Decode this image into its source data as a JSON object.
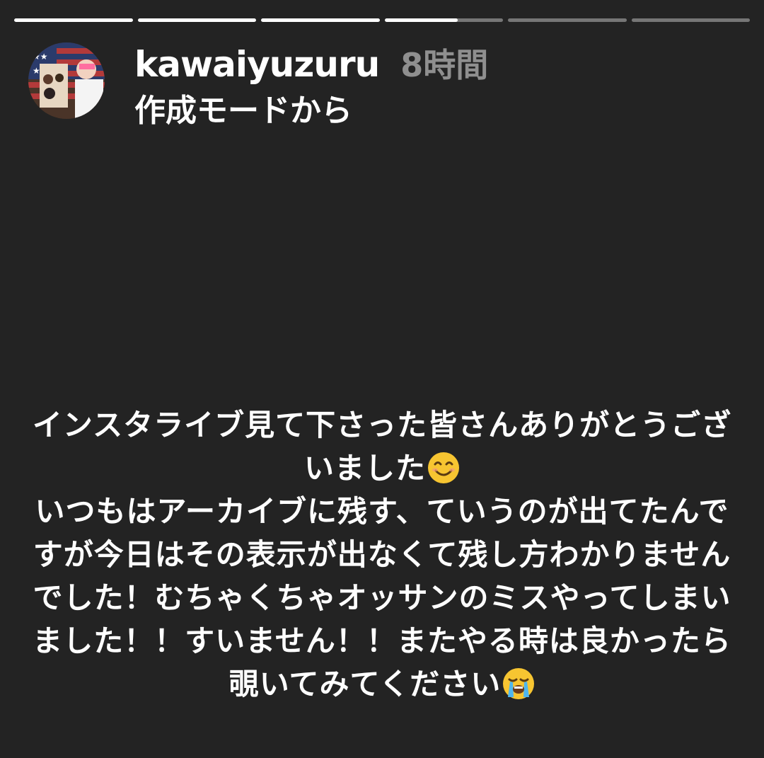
{
  "progress": {
    "segments": [
      1,
      1,
      1,
      0.62,
      0,
      0
    ],
    "fill_color": "#ffffff",
    "track_color": "rgba(255,255,255,0.38)"
  },
  "header": {
    "username": "kawaiyuzuru",
    "time": "8時間",
    "subtitle": "作成モードから",
    "avatar_icon": "profile-photo"
  },
  "caption": {
    "lines": [
      {
        "text": "インスタライブ見て下さった皆さんありがとうござ",
        "emoji": null
      },
      {
        "text": "いました",
        "emoji": "smiling-face-emoji"
      },
      {
        "text": "いつもはアーカイブに残す、ていうのが出てたんで",
        "emoji": null
      },
      {
        "text": "すが今日はその表示が出なくて残し方わかりません",
        "emoji": null
      },
      {
        "text": "でした！むちゃくちゃオッサンのミスやってしまい",
        "emoji": null
      },
      {
        "text": "ました！！すいません！！またやる時は良かったら",
        "emoji": null
      },
      {
        "text": "覗いてみてください",
        "emoji": "loudly-crying-face-emoji"
      }
    ]
  },
  "colors": {
    "background": "#232323",
    "text": "#ffffff",
    "time": "#8f8f8f"
  }
}
